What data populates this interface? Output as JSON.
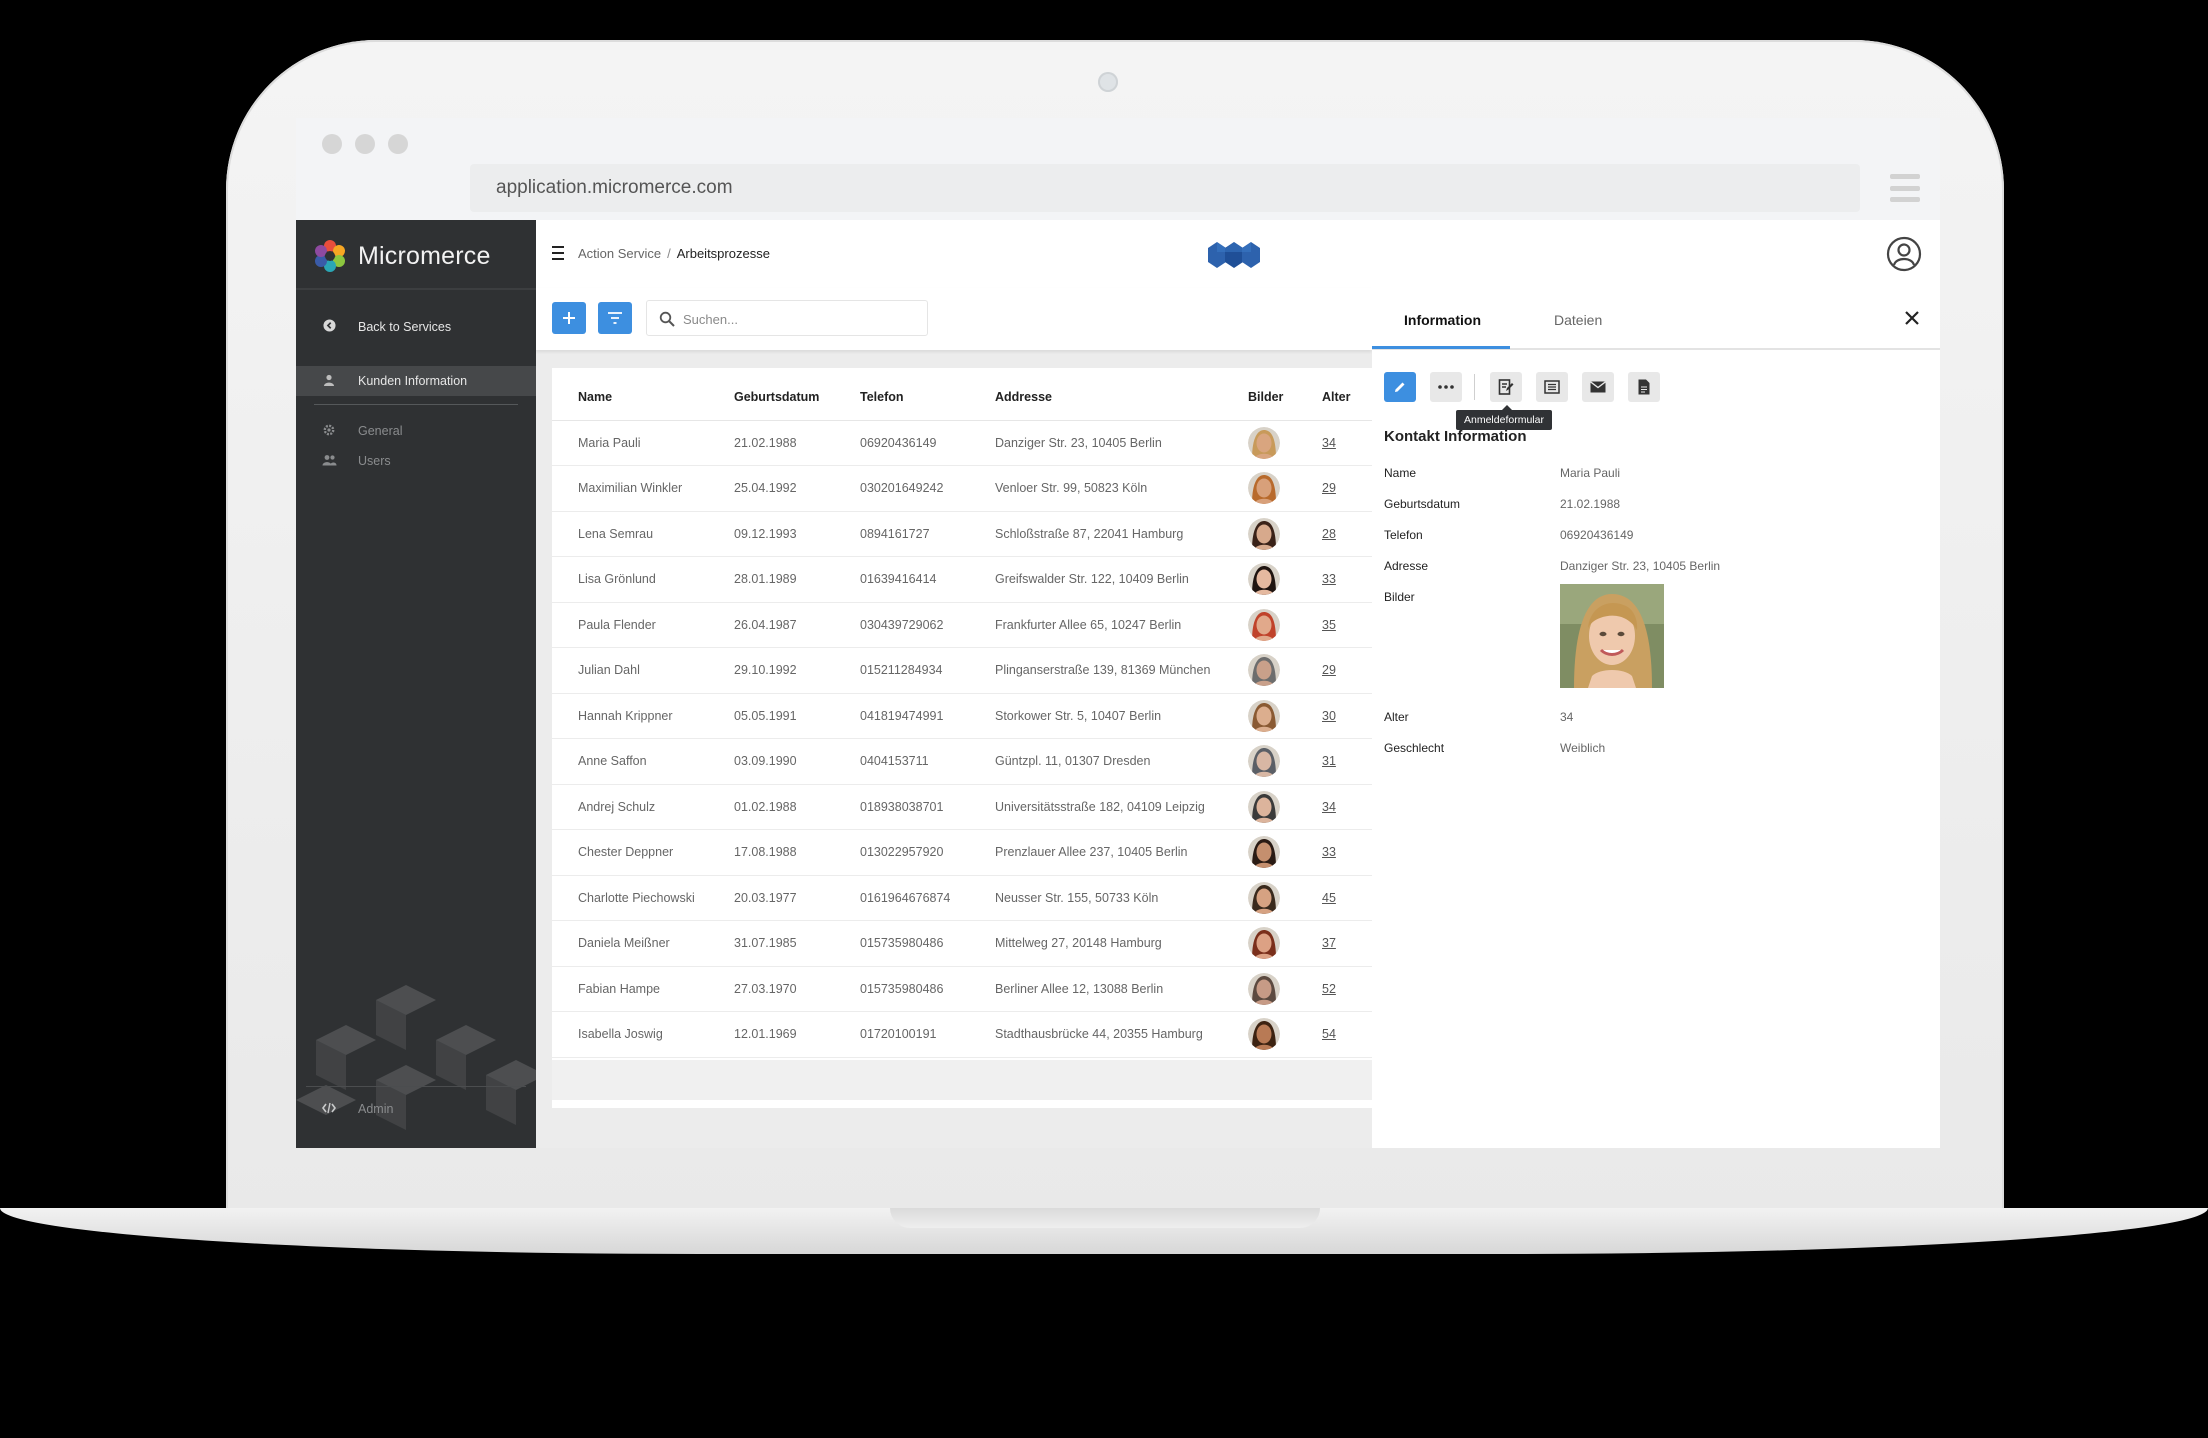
{
  "browser": {
    "url": "application.micromerce.com"
  },
  "sidebar": {
    "brand": "Micromerce",
    "back_label": "Back to Services",
    "items": [
      {
        "label": "Kunden Information",
        "icon": "person-icon"
      },
      {
        "label": "General",
        "icon": "gear-icon"
      },
      {
        "label": "Users",
        "icon": "users-icon"
      }
    ],
    "admin_label": "Admin"
  },
  "topbar": {
    "breadcrumb_parent": "Action Service",
    "breadcrumb_sep": "/",
    "breadcrumb_current": "Arbeitsprozesse"
  },
  "toolbar": {
    "search_placeholder": "Suchen..."
  },
  "table": {
    "columns": [
      "Name",
      "Geburtsdatum",
      "Telefon",
      "Addresse",
      "Bilder",
      "Alter"
    ],
    "rows": [
      {
        "name": "Maria Pauli",
        "birth": "21.02.1988",
        "phone": "06920436149",
        "address": "Danziger Str. 23, 10405 Berlin",
        "age": "34",
        "skin": "#d9a57f",
        "hair": "#c89a5a"
      },
      {
        "name": "Maximilian Winkler",
        "birth": "25.04.1992",
        "phone": "030201649242",
        "address": "Venloer Str. 99, 50823 Köln",
        "age": "29",
        "skin": "#d8a07a",
        "hair": "#b86a2c"
      },
      {
        "name": "Lena Semrau",
        "birth": "09.12.1993",
        "phone": "0894161727",
        "address": "Schloßstraße 87, 22041 Hamburg",
        "age": "28",
        "skin": "#d7a98c",
        "hair": "#3a2218"
      },
      {
        "name": "Lisa Grönlund",
        "birth": "28.01.1989",
        "phone": "01639416414",
        "address": "Greifswalder Str. 122, 10409 Berlin",
        "age": "33",
        "skin": "#e5b9a0",
        "hair": "#1f1410"
      },
      {
        "name": "Paula Flender",
        "birth": "26.04.1987",
        "phone": "030439729062",
        "address": "Frankfurter Allee 65, 10247 Berlin",
        "age": "35",
        "skin": "#e1a98b",
        "hair": "#c0432b"
      },
      {
        "name": "Julian Dahl",
        "birth": "29.10.1992",
        "phone": "015211284934",
        "address": "Plinganserstraße 139, 81369 München",
        "age": "29",
        "skin": "#c9a08a",
        "hair": "#6d6d6d"
      },
      {
        "name": "Hannah Krippner",
        "birth": "05.05.1991",
        "phone": "041819474991",
        "address": "Storkower Str. 5, 10407 Berlin",
        "age": "30",
        "skin": "#dcae8e",
        "hair": "#8a5a33"
      },
      {
        "name": "Anne Saffon",
        "birth": "03.09.1990",
        "phone": "0404153711",
        "address": "Güntzpl. 11, 01307 Dresden",
        "age": "31",
        "skin": "#d8b7a4",
        "hair": "#5b5f66"
      },
      {
        "name": "Andrej Schulz",
        "birth": "01.02.1988",
        "phone": "018938038701",
        "address": "Universitätsstraße 182, 04109 Leipzig",
        "age": "34",
        "skin": "#dcb49c",
        "hair": "#3b3b3b"
      },
      {
        "name": "Chester Deppner",
        "birth": "17.08.1988",
        "phone": "013022957920",
        "address": "Prenzlauer Allee 237, 10405 Berlin",
        "age": "33",
        "skin": "#c58f6e",
        "hair": "#2a1b14"
      },
      {
        "name": "Charlotte Piechowski",
        "birth": "20.03.1977",
        "phone": "0161964676874",
        "address": "Neusser Str. 155, 50733 Köln",
        "age": "45",
        "skin": "#d6a282",
        "hair": "#3a2a1d"
      },
      {
        "name": "Daniela Meißner",
        "birth": "31.07.1985",
        "phone": "015735980486",
        "address": "Mittelweg 27, 20148 Hamburg",
        "age": "37",
        "skin": "#dca184",
        "hair": "#7a2f1b"
      },
      {
        "name": "Fabian Hampe",
        "birth": "27.03.1970",
        "phone": "015735980486",
        "address": "Berliner Allee 12, 13088 Berlin",
        "age": "52",
        "skin": "#c79b86",
        "hair": "#5c4a40"
      },
      {
        "name": "Isabella Joswig",
        "birth": "12.01.1969",
        "phone": "01720100191",
        "address": "Stadthausbrücke 44, 20355 Hamburg",
        "age": "54",
        "skin": "#b87a55",
        "hair": "#3d2312"
      }
    ]
  },
  "detail": {
    "tabs": [
      "Information",
      "Dateien"
    ],
    "tooltip": "Anmeldeformular",
    "section_title": "Kontakt Information",
    "fields": [
      {
        "label": "Name",
        "value": "Maria Pauli"
      },
      {
        "label": "Geburtsdatum",
        "value": "21.02.1988"
      },
      {
        "label": "Telefon",
        "value": "06920436149"
      },
      {
        "label": "Adresse",
        "value": "Danziger Str. 23, 10405 Berlin"
      },
      {
        "label": "Bilder",
        "value": ""
      },
      {
        "label": "Alter",
        "value": "34"
      },
      {
        "label": "Geschlecht",
        "value": "Weiblich"
      }
    ]
  },
  "colors": {
    "accent": "#3d8fe0",
    "sidebar_bg": "#2f3133",
    "logo_blue": "#1f5aa6"
  }
}
